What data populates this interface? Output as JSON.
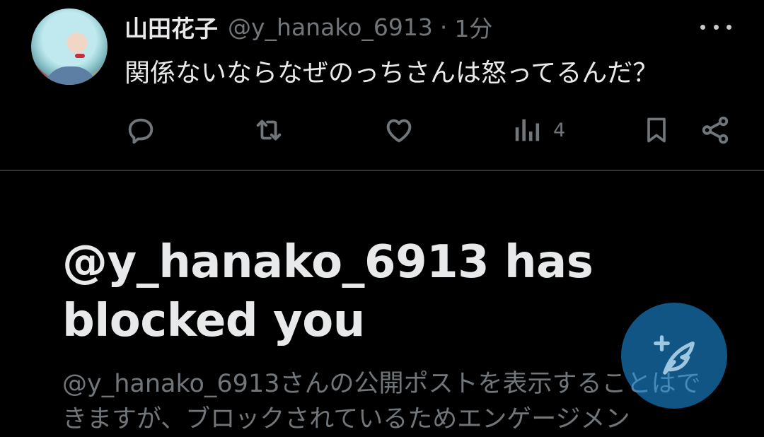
{
  "tweet": {
    "display_name": "山田花子",
    "handle": "@y_hanako_6913",
    "separator": "·",
    "time": "1分",
    "text": "関係ないならなぜのっちさんは怒ってるんだ？",
    "actions": {
      "reply_icon": "reply-icon",
      "retweet_icon": "retweet-icon",
      "like_icon": "heart-icon",
      "views_icon": "bar-chart-icon",
      "views_count": "4",
      "bookmark_icon": "bookmark-icon",
      "share_icon": "share-icon"
    },
    "more_icon": "more-icon"
  },
  "blocked": {
    "title": "@y_hanako_6913 has blocked you",
    "description": "@y_hanako_6913さんの公開ポストを表示することはできますが、ブロックされているためエンゲージメン"
  },
  "fab": {
    "icon": "compose-feather-icon"
  },
  "colors": {
    "background": "#000000",
    "primary_text": "#e7e9ea",
    "secondary_text": "#71767b",
    "divider": "#2f3336",
    "accent": "#1d9bf0"
  }
}
